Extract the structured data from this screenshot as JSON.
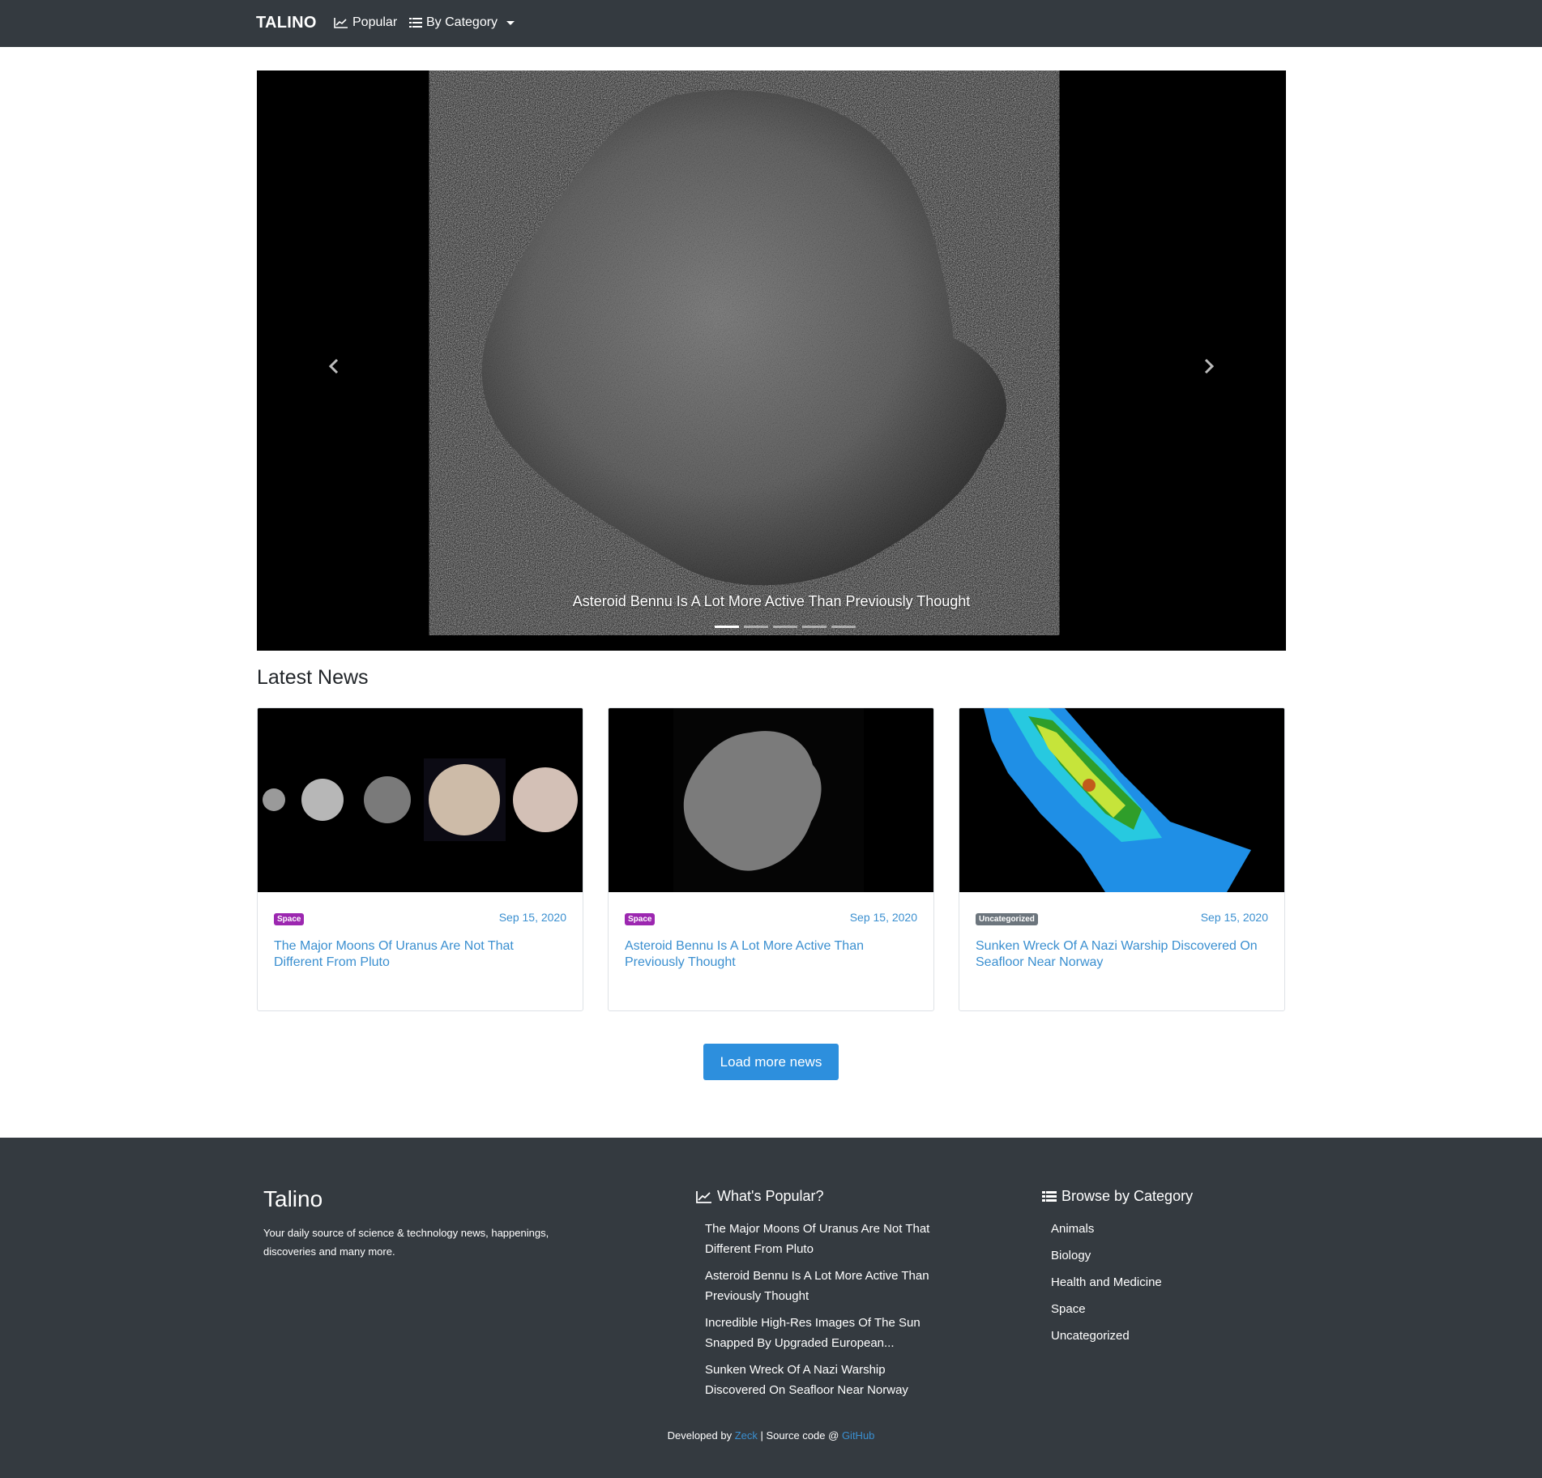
{
  "navbar": {
    "brand": "TALINO",
    "popular": "Popular",
    "category": "By Category"
  },
  "carousel": {
    "caption": "Asteroid Bennu Is A Lot More Active Than Previously Thought",
    "slides": 5,
    "active_index": 0
  },
  "latest": {
    "title": "Latest News",
    "cards": [
      {
        "badge": "Space",
        "date": "Sep 15, 2020",
        "title": "The Major Moons Of Uranus Are Not That Different From Pluto",
        "image": "uranus-moons"
      },
      {
        "badge": "Space",
        "date": "Sep 15, 2020",
        "title": "Asteroid Bennu Is A Lot More Active Than Previously Thought",
        "image": "asteroid-bennu"
      },
      {
        "badge": "Uncategorized",
        "date": "Sep 15, 2020",
        "title": "Sunken Wreck Of A Nazi Warship Discovered On Seafloor Near Norway",
        "image": "sonar-shipwreck"
      }
    ],
    "load_more": "Load more news"
  },
  "footer": {
    "brand": "Talino",
    "description": "Your daily source of science & technology news, happenings, discoveries and many more.",
    "popular_heading": "What's Popular?",
    "popular": [
      "The Major Moons Of Uranus Are Not That Different From Pluto",
      "Asteroid Bennu Is A Lot More Active Than Previously Thought",
      "Incredible High-Res Images Of The Sun Snapped By Upgraded European...",
      "Sunken Wreck Of A Nazi Warship Discovered On Seafloor Near Norway"
    ],
    "category_heading": "Browse by Category",
    "categories": [
      "Animals",
      "Biology",
      "Health and Medicine",
      "Space",
      "Uncategorized"
    ],
    "credit_prefix": "Developed by",
    "credit_author": "Zeck",
    "credit_middle": "| Source code @",
    "credit_link": "GitHub"
  },
  "colors": {
    "navbar_bg": "#343a40",
    "accent": "#2d8fdd",
    "link": "#3a8fd0",
    "badge_space": "#9c27b0",
    "badge_uncategorized": "#6c757d"
  }
}
